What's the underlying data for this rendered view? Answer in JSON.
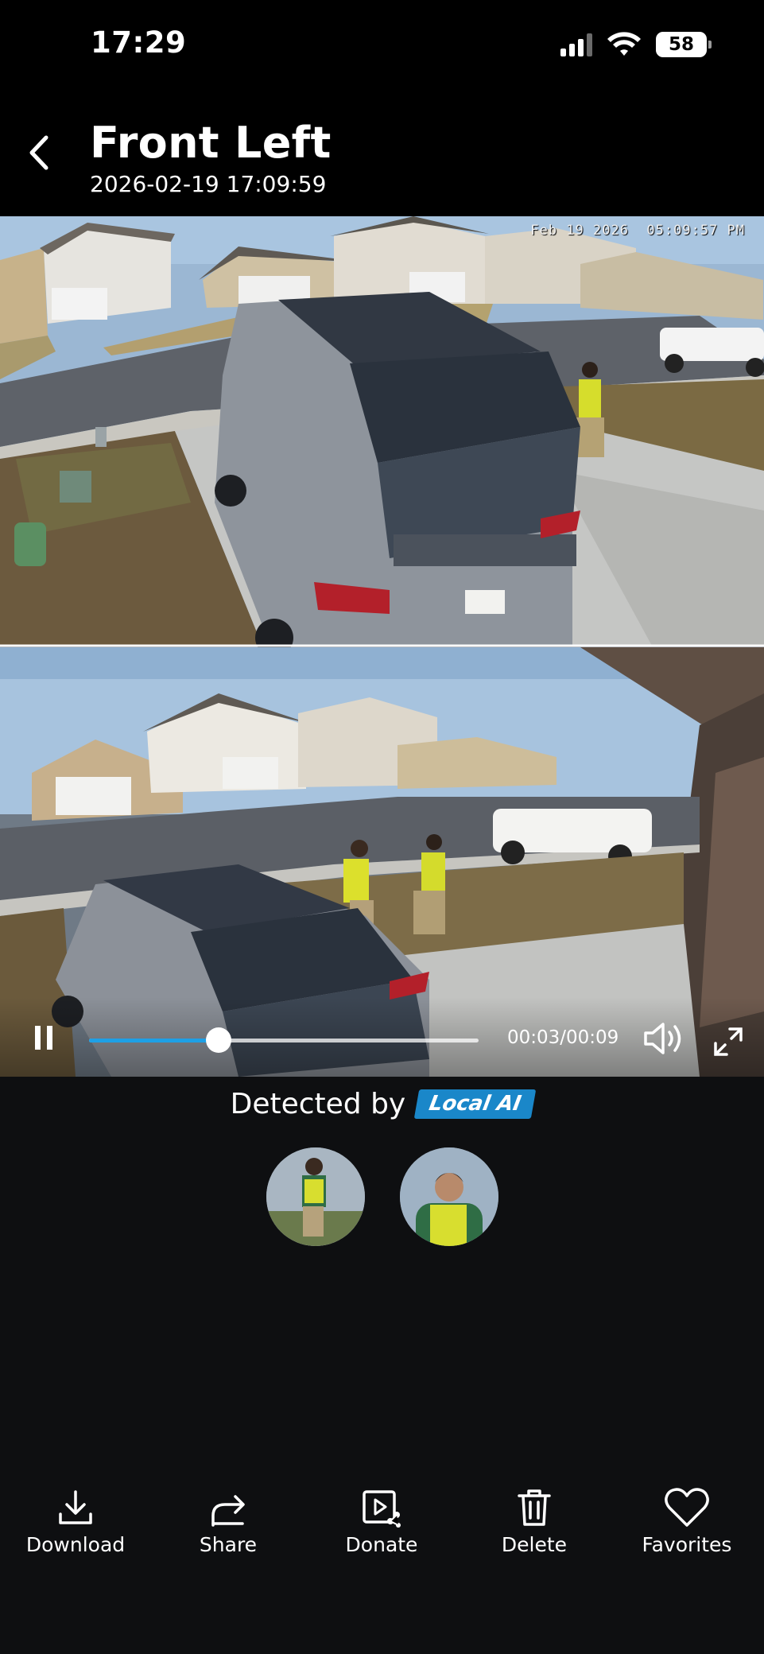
{
  "status_bar": {
    "time": "17:29",
    "battery": "58",
    "icons": [
      "cellular-signal-icon",
      "wifi-icon",
      "battery-icon"
    ]
  },
  "header": {
    "title": "Front Left",
    "subtitle": "2026-02-19 17:09:59",
    "back_icon": "chevron-left-icon"
  },
  "video": {
    "overlay_timestamp": "Feb 19 2026  05:09:57 PM",
    "time_readout": "00:03/00:09",
    "progress_fraction": 0.333,
    "controls": [
      "pause-icon",
      "volume-icon",
      "fullscreen-icon"
    ]
  },
  "detection": {
    "label": "Detected by",
    "badge": "Local AI",
    "thumbnail_count": 2
  },
  "toolbar": {
    "download": "Download",
    "share": "Share",
    "donate": "Donate",
    "delete": "Delete",
    "favorites": "Favorites"
  },
  "colors": {
    "background": "#0e0f11",
    "accent": "#1ea0e6",
    "badge": "#1a87c9"
  }
}
